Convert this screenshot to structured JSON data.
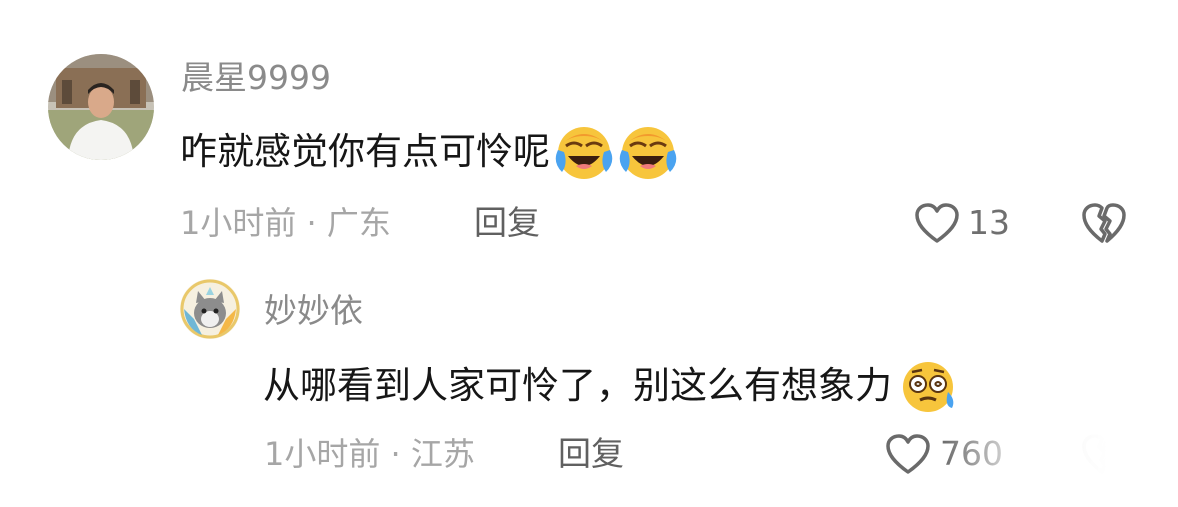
{
  "comments": [
    {
      "username": "晨星9999",
      "text": "咋就感觉你有点可怜呢",
      "emojis": [
        "laughing-crying-emoji",
        "laughing-crying-emoji"
      ],
      "time_location": "1小时前 · 广东",
      "reply_label": "回复",
      "like_count": "13"
    },
    {
      "username": "妙妙依",
      "text": "从哪看到人家可怜了，别这么有想象力",
      "emojis": [
        "dizzy-sweat-emoji"
      ],
      "time_location": "1小时前 · 江苏",
      "reply_label": "回复",
      "like_count": "760"
    }
  ],
  "icons": {
    "like": "heart-outline-icon",
    "dislike": "broken-heart-icon"
  }
}
